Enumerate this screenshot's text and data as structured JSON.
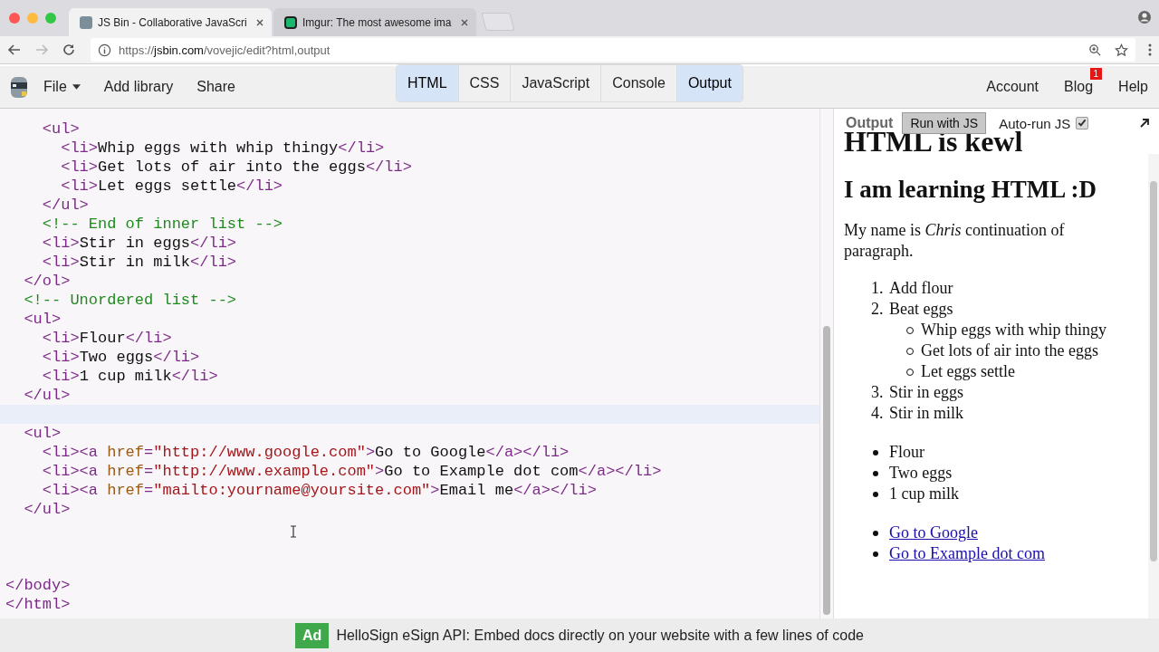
{
  "browser": {
    "tabs": [
      {
        "title": "JS Bin - Collaborative JavaScri",
        "selected": true
      },
      {
        "title": "Imgur: The most awesome ima",
        "selected": false
      }
    ],
    "url": {
      "host": "jsbin.com",
      "rest": "/vovejic/edit?html,output",
      "scheme": "https://"
    }
  },
  "toolbar": {
    "menu": [
      {
        "label": "File",
        "kind": "dropdown"
      },
      {
        "label": "Add library",
        "kind": "plain"
      },
      {
        "label": "Share",
        "kind": "plain"
      }
    ],
    "panels": [
      {
        "label": "HTML",
        "selected": true
      },
      {
        "label": "CSS",
        "selected": false
      },
      {
        "label": "JavaScript",
        "selected": false
      },
      {
        "label": "Console",
        "selected": false
      },
      {
        "label": "Output",
        "selected": true
      }
    ],
    "links": [
      {
        "label": "Account"
      },
      {
        "label": "Blog",
        "badge": "1"
      },
      {
        "label": "Help"
      }
    ]
  },
  "editor": {
    "lines": [
      {
        "tokens": [
          {
            "kind": "tag",
            "text": "    <ul>"
          }
        ]
      },
      {
        "tokens": [
          {
            "kind": "tag",
            "text": "      <li>"
          },
          {
            "kind": "text",
            "text": "Whip eggs with whip thingy"
          },
          {
            "kind": "tag",
            "text": "</li>"
          }
        ]
      },
      {
        "tokens": [
          {
            "kind": "tag",
            "text": "      <li>"
          },
          {
            "kind": "text",
            "text": "Get lots of air into the eggs"
          },
          {
            "kind": "tag",
            "text": "</li>"
          }
        ]
      },
      {
        "tokens": [
          {
            "kind": "tag",
            "text": "      <li>"
          },
          {
            "kind": "text",
            "text": "Let eggs settle"
          },
          {
            "kind": "tag",
            "text": "</li>"
          }
        ]
      },
      {
        "tokens": [
          {
            "kind": "tag",
            "text": "    </ul>"
          }
        ]
      },
      {
        "tokens": [
          {
            "kind": "comment",
            "text": "    <!-- End of inner list -->"
          }
        ]
      },
      {
        "tokens": [
          {
            "kind": "tag",
            "text": "    <li>"
          },
          {
            "kind": "text",
            "text": "Stir in eggs"
          },
          {
            "kind": "tag",
            "text": "</li>"
          }
        ]
      },
      {
        "tokens": [
          {
            "kind": "tag",
            "text": "    <li>"
          },
          {
            "kind": "text",
            "text": "Stir in milk"
          },
          {
            "kind": "tag",
            "text": "</li>"
          }
        ]
      },
      {
        "tokens": [
          {
            "kind": "tag",
            "text": "  </ol>"
          }
        ]
      },
      {
        "tokens": [
          {
            "kind": "comment",
            "text": "  <!-- Unordered list -->"
          }
        ]
      },
      {
        "tokens": [
          {
            "kind": "tag",
            "text": "  <ul>"
          }
        ]
      },
      {
        "tokens": [
          {
            "kind": "tag",
            "text": "    <li>"
          },
          {
            "kind": "text",
            "text": "Flour"
          },
          {
            "kind": "tag",
            "text": "</li>"
          }
        ]
      },
      {
        "tokens": [
          {
            "kind": "tag",
            "text": "    <li>"
          },
          {
            "kind": "text",
            "text": "Two eggs"
          },
          {
            "kind": "tag",
            "text": "</li>"
          }
        ]
      },
      {
        "tokens": [
          {
            "kind": "tag",
            "text": "    <li>"
          },
          {
            "kind": "text",
            "text": "1 cup milk"
          },
          {
            "kind": "tag",
            "text": "</li>"
          }
        ]
      },
      {
        "tokens": [
          {
            "kind": "tag",
            "text": "  </ul>"
          }
        ]
      },
      {
        "kind": "current"
      },
      {
        "tokens": [
          {
            "kind": "tag",
            "text": "  <ul>"
          }
        ]
      },
      {
        "tokens": [
          {
            "kind": "tag",
            "text": "    <li><a "
          },
          {
            "kind": "attr",
            "text": "href"
          },
          {
            "kind": "tag",
            "text": "="
          },
          {
            "kind": "string",
            "text": "\"http://www.google.com\""
          },
          {
            "kind": "tag",
            "text": ">"
          },
          {
            "kind": "text",
            "text": "Go to Google"
          },
          {
            "kind": "tag",
            "text": "</a></li>"
          }
        ]
      },
      {
        "tokens": [
          {
            "kind": "tag",
            "text": "    <li><a "
          },
          {
            "kind": "attr",
            "text": "href"
          },
          {
            "kind": "tag",
            "text": "="
          },
          {
            "kind": "string",
            "text": "\"http://www.example.com\""
          },
          {
            "kind": "tag",
            "text": ">"
          },
          {
            "kind": "text",
            "text": "Go to Example dot com"
          },
          {
            "kind": "tag",
            "text": "</a></li>"
          }
        ]
      },
      {
        "tokens": [
          {
            "kind": "tag",
            "text": "    <li><a "
          },
          {
            "kind": "attr",
            "text": "href"
          },
          {
            "kind": "tag",
            "text": "="
          },
          {
            "kind": "string",
            "text": "\"mailto:yourname@yoursite.com\""
          },
          {
            "kind": "tag",
            "text": ">"
          },
          {
            "kind": "text",
            "text": "Email me"
          },
          {
            "kind": "tag",
            "text": "</a></li>"
          }
        ]
      },
      {
        "tokens": [
          {
            "kind": "tag",
            "text": "  </ul>"
          }
        ]
      },
      {
        "kind": "blank"
      },
      {
        "kind": "blank"
      },
      {
        "kind": "blank"
      },
      {
        "tokens": [
          {
            "kind": "tag",
            "text": "</body>"
          }
        ]
      },
      {
        "tokens": [
          {
            "kind": "tag",
            "text": "</html>"
          }
        ]
      }
    ]
  },
  "output": {
    "label": "Output",
    "run_button": "Run with JS",
    "autorun": {
      "label": "Auto-run JS",
      "checked": true
    },
    "heading1": "HTML is kewl",
    "heading2": "I am learning HTML :D",
    "paragraph": "My name is *Chris* continuation of paragraph.",
    "ordered": [
      {
        "text": "Add flour"
      },
      {
        "text": "Beat eggs",
        "children": [
          "Whip eggs with whip thingy",
          "Get lots of air into the eggs",
          "Let eggs settle"
        ]
      },
      {
        "text": "Stir in eggs"
      },
      {
        "text": "Stir in milk"
      }
    ],
    "ordered_numbers": [
      "1.",
      "2.",
      "3.",
      "4."
    ],
    "bullets": [
      "Flour",
      "Two eggs",
      "1 cup milk"
    ],
    "links": [
      "Go to Google",
      "Go to Example dot com"
    ]
  },
  "ad": {
    "badge": "Ad",
    "text": "HelloSign eSign API: Embed docs directly on your website with a few lines of code"
  }
}
